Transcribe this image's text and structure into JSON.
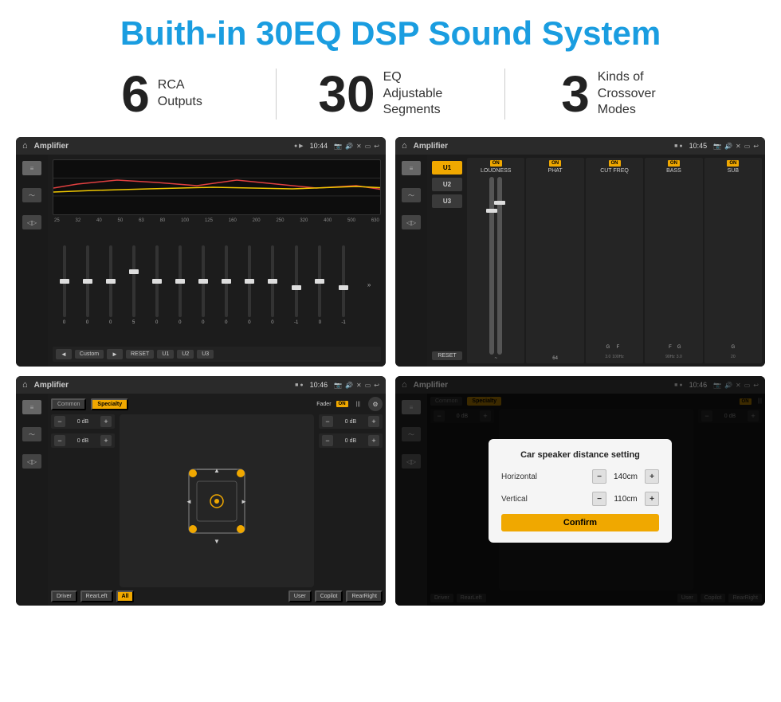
{
  "header": {
    "title": "Buith-in 30EQ DSP Sound System"
  },
  "stats": [
    {
      "number": "6",
      "line1": "RCA",
      "line2": "Outputs"
    },
    {
      "number": "30",
      "line1": "EQ Adjustable",
      "line2": "Segments"
    },
    {
      "number": "3",
      "line1": "Kinds of",
      "line2": "Crossover Modes"
    }
  ],
  "screens": {
    "eq": {
      "topbar": {
        "title": "Amplifier",
        "time": "10:44"
      },
      "freq_labels": [
        "25",
        "32",
        "40",
        "50",
        "63",
        "80",
        "100",
        "125",
        "160",
        "200",
        "250",
        "320",
        "400",
        "500",
        "630"
      ],
      "sliders": [
        {
          "val": "0"
        },
        {
          "val": "0"
        },
        {
          "val": "0"
        },
        {
          "val": "5"
        },
        {
          "val": "0"
        },
        {
          "val": "0"
        },
        {
          "val": "0"
        },
        {
          "val": "0"
        },
        {
          "val": "0"
        },
        {
          "val": "0"
        },
        {
          "val": "-1"
        },
        {
          "val": "0"
        },
        {
          "val": "-1"
        }
      ],
      "bottom_buttons": [
        "◄",
        "Custom",
        "►",
        "RESET",
        "U1",
        "U2",
        "U3"
      ]
    },
    "crossover": {
      "topbar": {
        "title": "Amplifier",
        "time": "10:45"
      },
      "presets": [
        "U1",
        "U2",
        "U3"
      ],
      "columns": [
        {
          "name": "LOUDNESS",
          "on": true,
          "val": ""
        },
        {
          "name": "PHAT",
          "on": true,
          "val": ""
        },
        {
          "name": "CUT FREQ",
          "on": true,
          "val": ""
        },
        {
          "name": "BASS",
          "on": true,
          "val": ""
        },
        {
          "name": "SUB",
          "on": true,
          "val": ""
        }
      ],
      "reset_label": "RESET"
    },
    "speaker": {
      "topbar": {
        "title": "Amplifier",
        "time": "10:46"
      },
      "tabs": [
        "Common",
        "Specialty"
      ],
      "active_tab": "Specialty",
      "fader_label": "Fader",
      "fader_on": "ON",
      "db_controls": [
        "0 dB",
        "0 dB",
        "0 dB",
        "0 dB"
      ],
      "position_buttons": [
        "Driver",
        "RearLeft",
        "All",
        "User",
        "Copilot",
        "RearRight"
      ]
    },
    "speaker_dialog": {
      "topbar": {
        "title": "Amplifier",
        "time": "10:46"
      },
      "tabs": [
        "Common",
        "Specialty"
      ],
      "active_tab": "Specialty",
      "fader_on": "ON",
      "dialog": {
        "title": "Car speaker distance setting",
        "horizontal_label": "Horizontal",
        "horizontal_value": "140cm",
        "vertical_label": "Vertical",
        "vertical_value": "110cm",
        "confirm_label": "Confirm"
      },
      "db_controls_right": [
        "0 dB",
        "0 dB"
      ],
      "bottom_buttons": [
        "Driver",
        "RearLeft",
        "All",
        "User",
        "Copilot",
        "RearRight"
      ]
    }
  }
}
